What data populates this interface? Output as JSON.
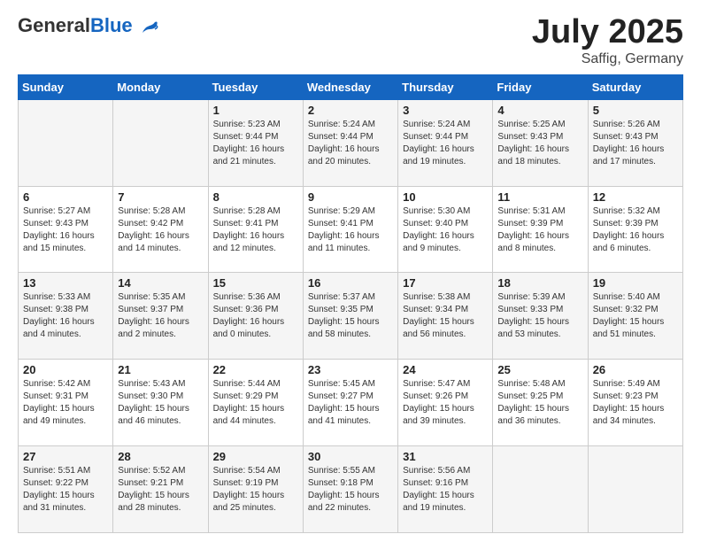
{
  "header": {
    "logo": {
      "general": "General",
      "blue": "Blue"
    },
    "title": "July 2025",
    "location": "Saffig, Germany"
  },
  "calendar": {
    "days_of_week": [
      "Sunday",
      "Monday",
      "Tuesday",
      "Wednesday",
      "Thursday",
      "Friday",
      "Saturday"
    ],
    "weeks": [
      [
        {
          "day": "",
          "sunrise": "",
          "sunset": "",
          "daylight": ""
        },
        {
          "day": "",
          "sunrise": "",
          "sunset": "",
          "daylight": ""
        },
        {
          "day": "1",
          "sunrise": "Sunrise: 5:23 AM",
          "sunset": "Sunset: 9:44 PM",
          "daylight": "Daylight: 16 hours and 21 minutes."
        },
        {
          "day": "2",
          "sunrise": "Sunrise: 5:24 AM",
          "sunset": "Sunset: 9:44 PM",
          "daylight": "Daylight: 16 hours and 20 minutes."
        },
        {
          "day": "3",
          "sunrise": "Sunrise: 5:24 AM",
          "sunset": "Sunset: 9:44 PM",
          "daylight": "Daylight: 16 hours and 19 minutes."
        },
        {
          "day": "4",
          "sunrise": "Sunrise: 5:25 AM",
          "sunset": "Sunset: 9:43 PM",
          "daylight": "Daylight: 16 hours and 18 minutes."
        },
        {
          "day": "5",
          "sunrise": "Sunrise: 5:26 AM",
          "sunset": "Sunset: 9:43 PM",
          "daylight": "Daylight: 16 hours and 17 minutes."
        }
      ],
      [
        {
          "day": "6",
          "sunrise": "Sunrise: 5:27 AM",
          "sunset": "Sunset: 9:43 PM",
          "daylight": "Daylight: 16 hours and 15 minutes."
        },
        {
          "day": "7",
          "sunrise": "Sunrise: 5:28 AM",
          "sunset": "Sunset: 9:42 PM",
          "daylight": "Daylight: 16 hours and 14 minutes."
        },
        {
          "day": "8",
          "sunrise": "Sunrise: 5:28 AM",
          "sunset": "Sunset: 9:41 PM",
          "daylight": "Daylight: 16 hours and 12 minutes."
        },
        {
          "day": "9",
          "sunrise": "Sunrise: 5:29 AM",
          "sunset": "Sunset: 9:41 PM",
          "daylight": "Daylight: 16 hours and 11 minutes."
        },
        {
          "day": "10",
          "sunrise": "Sunrise: 5:30 AM",
          "sunset": "Sunset: 9:40 PM",
          "daylight": "Daylight: 16 hours and 9 minutes."
        },
        {
          "day": "11",
          "sunrise": "Sunrise: 5:31 AM",
          "sunset": "Sunset: 9:39 PM",
          "daylight": "Daylight: 16 hours and 8 minutes."
        },
        {
          "day": "12",
          "sunrise": "Sunrise: 5:32 AM",
          "sunset": "Sunset: 9:39 PM",
          "daylight": "Daylight: 16 hours and 6 minutes."
        }
      ],
      [
        {
          "day": "13",
          "sunrise": "Sunrise: 5:33 AM",
          "sunset": "Sunset: 9:38 PM",
          "daylight": "Daylight: 16 hours and 4 minutes."
        },
        {
          "day": "14",
          "sunrise": "Sunrise: 5:35 AM",
          "sunset": "Sunset: 9:37 PM",
          "daylight": "Daylight: 16 hours and 2 minutes."
        },
        {
          "day": "15",
          "sunrise": "Sunrise: 5:36 AM",
          "sunset": "Sunset: 9:36 PM",
          "daylight": "Daylight: 16 hours and 0 minutes."
        },
        {
          "day": "16",
          "sunrise": "Sunrise: 5:37 AM",
          "sunset": "Sunset: 9:35 PM",
          "daylight": "Daylight: 15 hours and 58 minutes."
        },
        {
          "day": "17",
          "sunrise": "Sunrise: 5:38 AM",
          "sunset": "Sunset: 9:34 PM",
          "daylight": "Daylight: 15 hours and 56 minutes."
        },
        {
          "day": "18",
          "sunrise": "Sunrise: 5:39 AM",
          "sunset": "Sunset: 9:33 PM",
          "daylight": "Daylight: 15 hours and 53 minutes."
        },
        {
          "day": "19",
          "sunrise": "Sunrise: 5:40 AM",
          "sunset": "Sunset: 9:32 PM",
          "daylight": "Daylight: 15 hours and 51 minutes."
        }
      ],
      [
        {
          "day": "20",
          "sunrise": "Sunrise: 5:42 AM",
          "sunset": "Sunset: 9:31 PM",
          "daylight": "Daylight: 15 hours and 49 minutes."
        },
        {
          "day": "21",
          "sunrise": "Sunrise: 5:43 AM",
          "sunset": "Sunset: 9:30 PM",
          "daylight": "Daylight: 15 hours and 46 minutes."
        },
        {
          "day": "22",
          "sunrise": "Sunrise: 5:44 AM",
          "sunset": "Sunset: 9:29 PM",
          "daylight": "Daylight: 15 hours and 44 minutes."
        },
        {
          "day": "23",
          "sunrise": "Sunrise: 5:45 AM",
          "sunset": "Sunset: 9:27 PM",
          "daylight": "Daylight: 15 hours and 41 minutes."
        },
        {
          "day": "24",
          "sunrise": "Sunrise: 5:47 AM",
          "sunset": "Sunset: 9:26 PM",
          "daylight": "Daylight: 15 hours and 39 minutes."
        },
        {
          "day": "25",
          "sunrise": "Sunrise: 5:48 AM",
          "sunset": "Sunset: 9:25 PM",
          "daylight": "Daylight: 15 hours and 36 minutes."
        },
        {
          "day": "26",
          "sunrise": "Sunrise: 5:49 AM",
          "sunset": "Sunset: 9:23 PM",
          "daylight": "Daylight: 15 hours and 34 minutes."
        }
      ],
      [
        {
          "day": "27",
          "sunrise": "Sunrise: 5:51 AM",
          "sunset": "Sunset: 9:22 PM",
          "daylight": "Daylight: 15 hours and 31 minutes."
        },
        {
          "day": "28",
          "sunrise": "Sunrise: 5:52 AM",
          "sunset": "Sunset: 9:21 PM",
          "daylight": "Daylight: 15 hours and 28 minutes."
        },
        {
          "day": "29",
          "sunrise": "Sunrise: 5:54 AM",
          "sunset": "Sunset: 9:19 PM",
          "daylight": "Daylight: 15 hours and 25 minutes."
        },
        {
          "day": "30",
          "sunrise": "Sunrise: 5:55 AM",
          "sunset": "Sunset: 9:18 PM",
          "daylight": "Daylight: 15 hours and 22 minutes."
        },
        {
          "day": "31",
          "sunrise": "Sunrise: 5:56 AM",
          "sunset": "Sunset: 9:16 PM",
          "daylight": "Daylight: 15 hours and 19 minutes."
        },
        {
          "day": "",
          "sunrise": "",
          "sunset": "",
          "daylight": ""
        },
        {
          "day": "",
          "sunrise": "",
          "sunset": "",
          "daylight": ""
        }
      ]
    ]
  }
}
